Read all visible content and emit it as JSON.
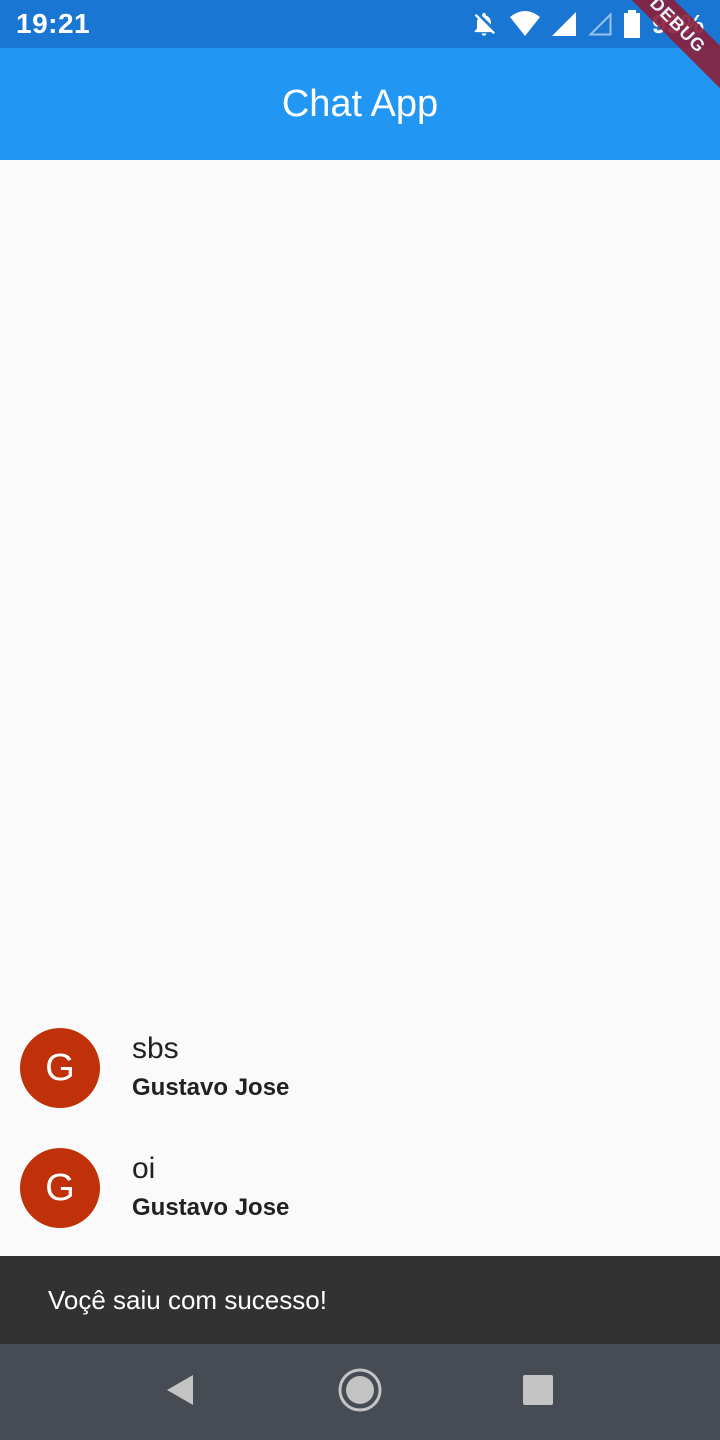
{
  "status_bar": {
    "time": "19:21",
    "battery": "95%",
    "icons": [
      "notifications-off-icon",
      "wifi-icon",
      "signal-icon",
      "signal-empty-icon",
      "battery-icon"
    ]
  },
  "app_bar": {
    "title": "Chat App"
  },
  "debug_banner": "DEBUG",
  "messages": [
    {
      "avatar_letter": "G",
      "text": "sbs",
      "sender": "Gustavo Jose"
    },
    {
      "avatar_letter": "G",
      "text": "oi",
      "sender": "Gustavo Jose"
    }
  ],
  "snackbar": {
    "text": "Voçê saiu com sucesso!"
  },
  "nav_bar": {
    "icons": [
      "back-icon",
      "home-icon",
      "recents-icon"
    ]
  },
  "colors": {
    "status_bar": "#1976d2",
    "app_bar": "#2196f3",
    "avatar": "#c0310a",
    "snackbar": "#323232",
    "nav_bar": "#474c54",
    "background": "#fafafa"
  }
}
